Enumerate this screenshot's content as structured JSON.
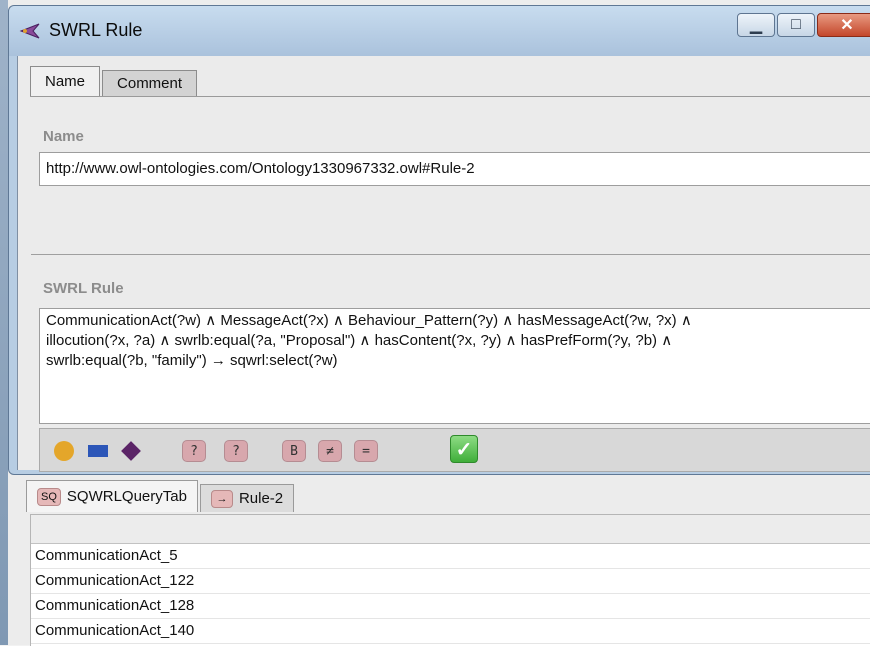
{
  "window": {
    "title": "SWRL Rule"
  },
  "tabs": [
    {
      "label": "Name",
      "active": true
    },
    {
      "label": "Comment",
      "active": false
    }
  ],
  "name_section": {
    "label": "Name",
    "value": "http://www.owl-ontologies.com/Ontology1330967332.owl#Rule-2"
  },
  "rule_section": {
    "label": "SWRL Rule",
    "lines": [
      "CommunicationAct(?w) ∧ MessageAct(?x) ∧ Behaviour_Pattern(?y) ∧ hasMessageAct(?w, ?x) ∧",
      " illocution(?x, ?a) ∧ swrlb:equal(?a, \"Proposal\") ∧ hasContent(?x, ?y) ∧ hasPrefForm(?y, ?b) ∧",
      "swrlb:equal(?b, \"family\") → sqwrl:select(?w)"
    ]
  },
  "toolbar": {
    "icons": [
      "class-circle-icon",
      "datatype-rect-icon",
      "individual-diamond-icon",
      "variable-question-icon",
      "add-variable-icon",
      "builtin-icon",
      "different-from-icon",
      "same-as-icon",
      "ok-check-icon"
    ],
    "builtin_label": "B",
    "neq_label": "≠",
    "eq_label": "="
  },
  "bottom_panel": {
    "tabs": [
      {
        "badge": "SQ",
        "label": "SQWRLQueryTab",
        "active": true
      },
      {
        "badge": "→",
        "label": "Rule-2",
        "active": false
      }
    ],
    "results": [
      "CommunicationAct_5",
      "CommunicationAct_122",
      "CommunicationAct_128",
      "CommunicationAct_140"
    ]
  },
  "colors": {
    "titlebar": "#aac2dc",
    "circle": "#e4a62a",
    "rect": "#2c56b8",
    "diamond": "#5b2467",
    "pill": "#d8a7ad",
    "check": "#3fae3a"
  }
}
